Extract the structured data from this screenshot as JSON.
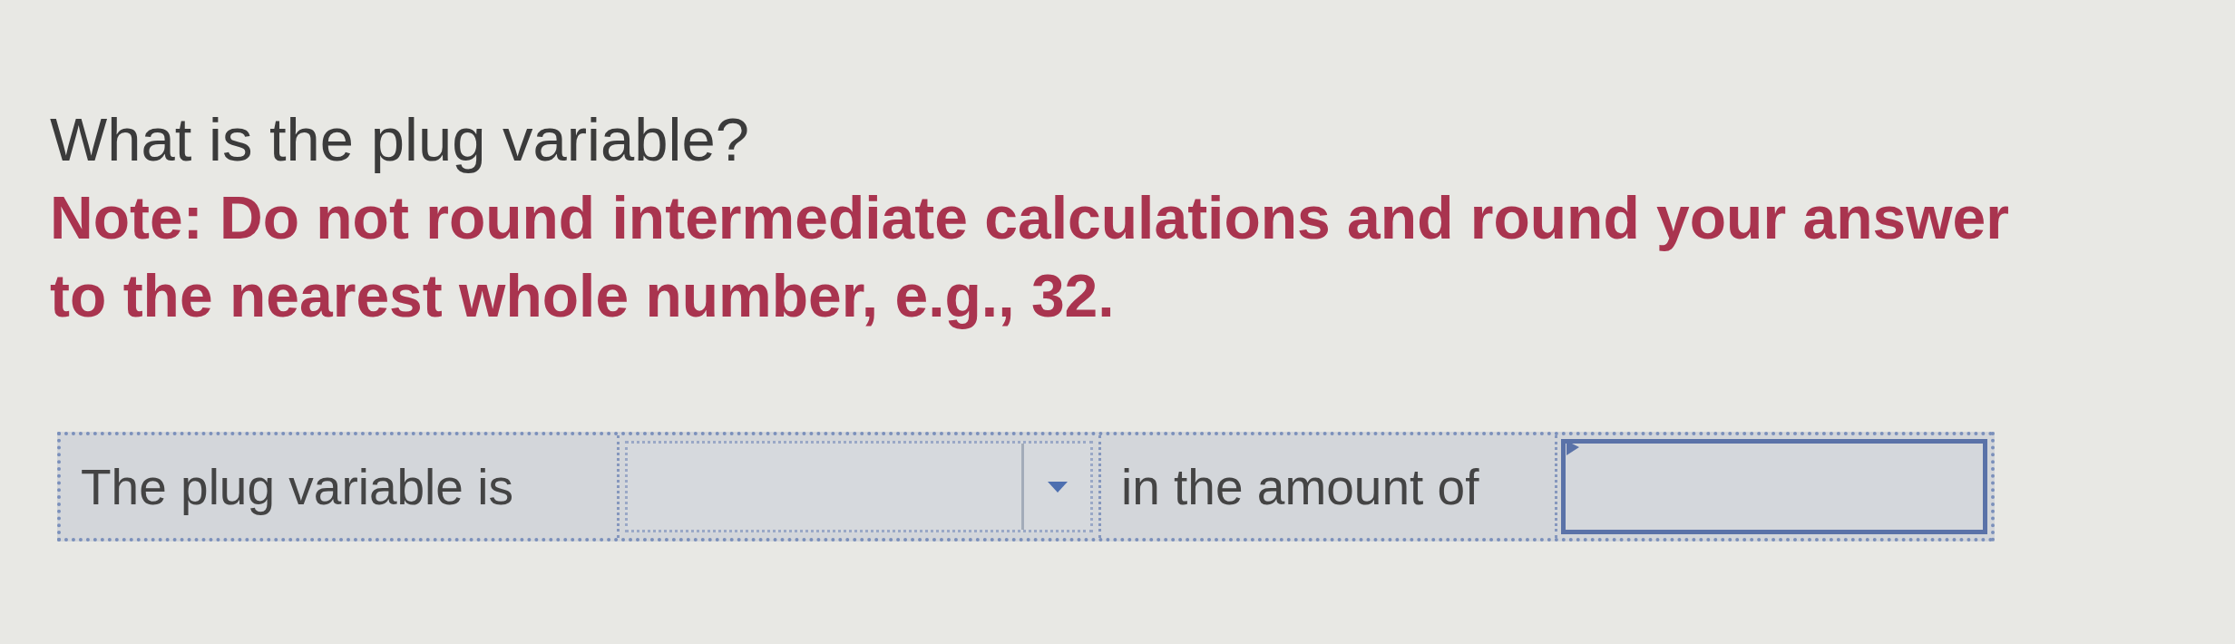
{
  "question": "What is the plug variable?",
  "note": "Note: Do not round intermediate calculations and round your answer to the nearest whole number, e.g., 32.",
  "answer_row": [
    {
      "kind": "text",
      "text": "The plug variable is"
    },
    {
      "kind": "select"
    },
    {
      "kind": "text",
      "text": "in the amount of"
    },
    {
      "kind": "input"
    }
  ]
}
